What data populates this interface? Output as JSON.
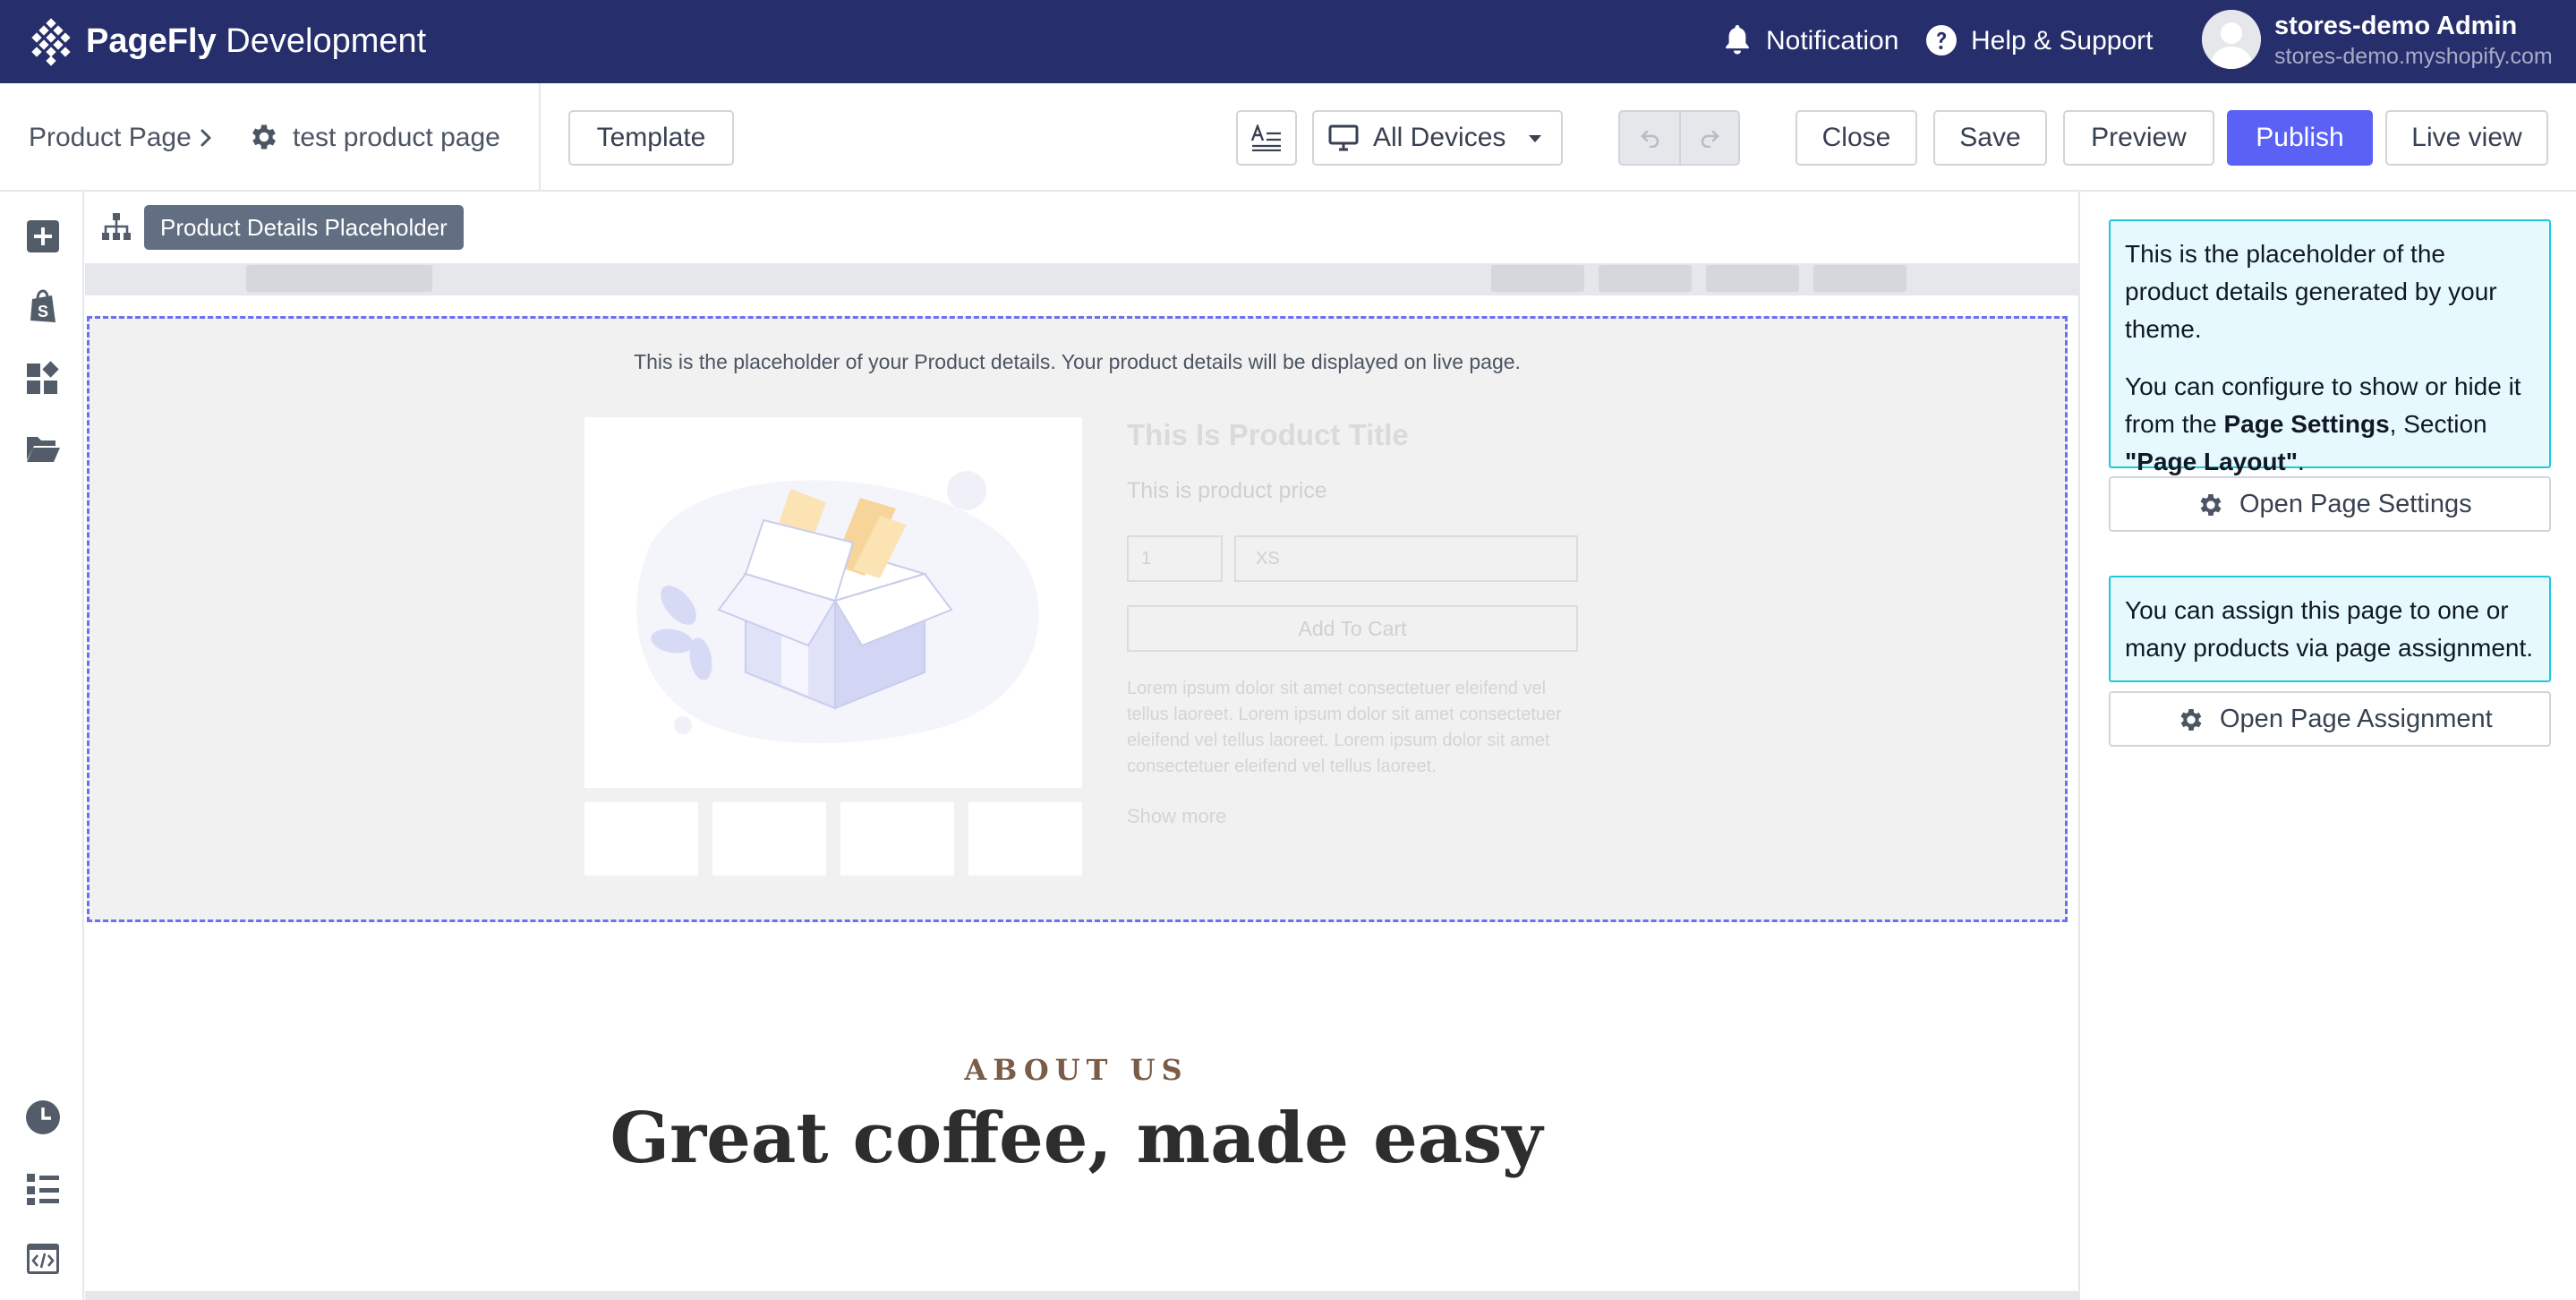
{
  "topbar": {
    "brand_bold": "PageFly",
    "brand_rest": " Development",
    "notification_label": "Notification",
    "help_label": "Help & Support",
    "user_name": "stores-demo Admin",
    "user_store": "stores-demo.myshopify.com"
  },
  "toolbar": {
    "breadcrumb_root": "Product Page",
    "breadcrumb_current": "test product page",
    "template_label": "Template",
    "devices_label": "All Devices",
    "close_label": "Close",
    "save_label": "Save",
    "preview_label": "Preview",
    "publish_label": "Publish",
    "live_view_label": "Live view"
  },
  "sidebar": {
    "top_icons": [
      "add-element-icon",
      "shopify-icon",
      "sections-icon",
      "folder-icon"
    ],
    "bottom_icons": [
      "history-icon",
      "layers-icon",
      "code-icon"
    ]
  },
  "canvas": {
    "selected_element_label": "Product Details Placeholder",
    "placeholder": {
      "note": "This is the placeholder of your Product details. Your product details will be displayed on live page.",
      "product_title": "This Is Product Title",
      "product_price": "This is product price",
      "quantity": "1",
      "variant": "XS",
      "add_to_cart": "Add To Cart",
      "description": "Lorem ipsum dolor sit amet consectetuer eleifend vel tellus laoreet. Lorem ipsum dolor sit amet consectetuer eleifend vel tellus laoreet. Lorem ipsum dolor sit amet consectetuer eleifend vel tellus laoreet.",
      "show_more": "Show more"
    },
    "about": {
      "kicker": "ABOUT US",
      "heading": "Great coffee, made easy"
    }
  },
  "right_panel": {
    "info1_line1": "This is the placeholder of the product details generated by your theme.",
    "info1_prefix": "You can configure to show or hide it from the ",
    "info1_bold1": "Page Settings",
    "info1_mid": ", Section ",
    "info1_bold2": "\"Page Layout\"",
    "info1_end": ".",
    "open_page_settings": "Open Page Settings",
    "info2": "You can assign this page to one or many products via page assignment.",
    "open_page_assignment": "Open Page Assignment"
  },
  "colors": {
    "topbar_bg": "#262e6c",
    "publish_bg": "#5b61f5",
    "info_bg": "#e6fafd",
    "info_border": "#22c7dd",
    "placeholder_border": "#6b6ff0"
  }
}
